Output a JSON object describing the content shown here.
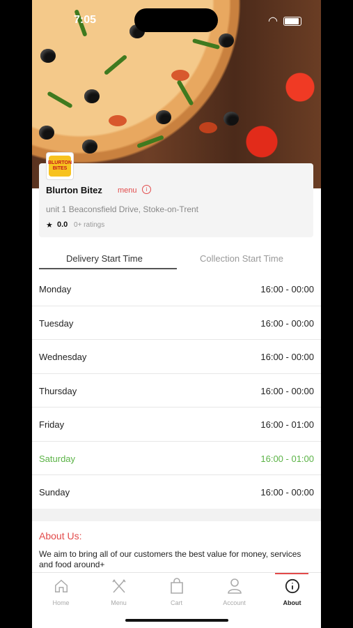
{
  "status_bar": {
    "time": "7:05"
  },
  "restaurant": {
    "logo_text": "BLURTON BITES",
    "name": "Blurton Bitez",
    "menu_link": "menu",
    "address": "unit 1 Beaconsfield Drive, Stoke-on-Trent",
    "rating": "0.0",
    "rating_count": "0+ ratings"
  },
  "tabs": {
    "delivery": "Delivery Start Time",
    "collection": "Collection Start Time",
    "active": "delivery"
  },
  "schedule": [
    {
      "day": "Monday",
      "hours": "16:00 - 00:00",
      "today": false
    },
    {
      "day": "Tuesday",
      "hours": "16:00 - 00:00",
      "today": false
    },
    {
      "day": "Wednesday",
      "hours": "16:00 - 00:00",
      "today": false
    },
    {
      "day": "Thursday",
      "hours": "16:00 - 00:00",
      "today": false
    },
    {
      "day": "Friday",
      "hours": "16:00 - 01:00",
      "today": false
    },
    {
      "day": "Saturday",
      "hours": "16:00 - 01:00",
      "today": true
    },
    {
      "day": "Sunday",
      "hours": "16:00 - 00:00",
      "today": false
    }
  ],
  "about": {
    "title": "About Us:",
    "text": "We aim to bring all of our customers the best value for money, services and food around+"
  },
  "nav": {
    "items": [
      {
        "label": "Home",
        "icon": "home-icon"
      },
      {
        "label": "Menu",
        "icon": "fork-knife-icon"
      },
      {
        "label": "Cart",
        "icon": "shopping-bag-icon"
      },
      {
        "label": "Account",
        "icon": "user-icon"
      },
      {
        "label": "About",
        "icon": "info-icon"
      }
    ],
    "active": "About"
  },
  "colors": {
    "accent": "#e24a4a",
    "today": "#5bb346"
  }
}
